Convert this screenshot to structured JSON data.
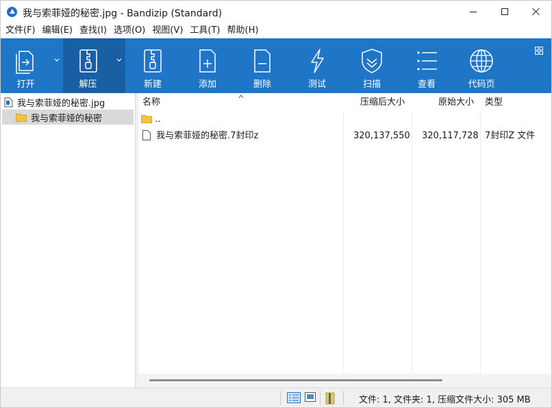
{
  "window": {
    "title": "我与索菲娅的秘密.jpg - Bandizip (Standard)"
  },
  "menu": [
    "文件(F)",
    "编辑(E)",
    "查找(I)",
    "选项(O)",
    "视图(V)",
    "工具(T)",
    "帮助(H)"
  ],
  "toolbar": {
    "open_label": "打开",
    "extract_label": "解压",
    "new_label": "新建",
    "add_label": "添加",
    "delete_label": "删除",
    "test_label": "测试",
    "scan_label": "扫描",
    "view_label": "查看",
    "codepage_label": "代码页",
    "background_color": "#1f75c6",
    "active_color": "#195fa3"
  },
  "tree": {
    "root_label": "我与索菲娅的秘密.jpg",
    "child_label": "我与索菲娅的秘密"
  },
  "columns": {
    "name": "名称",
    "compressed": "压缩后大小",
    "original": "原始大小",
    "type": "类型"
  },
  "rows": {
    "parent": {
      "name": ".."
    },
    "file": {
      "name": "我与索菲娅的秘密.7封印z",
      "compressed": "320,137,550",
      "original": "320,117,728",
      "type": "7封印Z 文件"
    }
  },
  "status": {
    "summary": "文件: 1, 文件夹: 1, 压缩文件大小: 305 MB"
  },
  "icons": {
    "app": "bandizip-app-icon",
    "folder_color": "#f3c443"
  }
}
